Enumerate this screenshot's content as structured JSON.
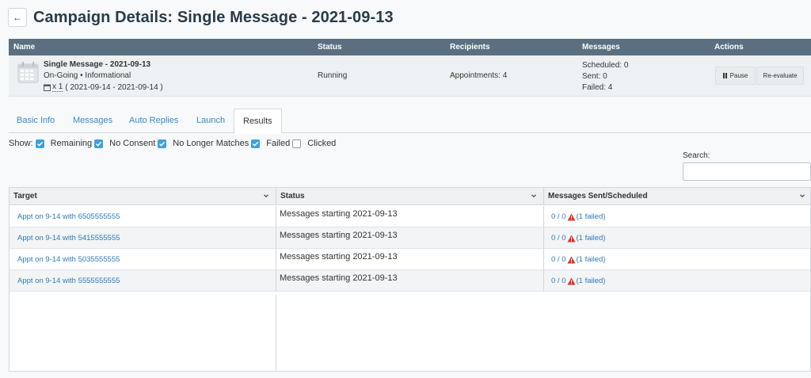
{
  "header": {
    "title": "Campaign Details: Single Message - 2021-09-13",
    "back_icon": "arrow-left-icon"
  },
  "campaign_table": {
    "columns": [
      "Name",
      "Status",
      "Recipients",
      "Messages",
      "Actions"
    ],
    "row": {
      "name": "Single Message - 2021-09-13",
      "subtitle": "On-Going • Informational",
      "count": "x 1",
      "range": "( 2021-09-14 - 2021-09-14 )",
      "status": "Running",
      "recipients": "Appointments: 4",
      "scheduled": "Scheduled: 0",
      "sent": "Sent: 0",
      "failed": "Failed: 4",
      "pause_label": "Pause",
      "reevaluate_label": "Re-evaluate"
    }
  },
  "tabs": [
    "Basic Info",
    "Messages",
    "Auto Replies",
    "Launch",
    "Results"
  ],
  "active_tab": "Results",
  "filters": {
    "show_label": "Show:",
    "items": [
      {
        "label": "Remaining",
        "checked": true
      },
      {
        "label": "No Consent",
        "checked": true
      },
      {
        "label": "No Longer Matches",
        "checked": true
      },
      {
        "label": "Failed",
        "checked": true
      },
      {
        "label": "Clicked",
        "checked": false
      }
    ]
  },
  "search": {
    "label": "Search:",
    "value": ""
  },
  "results": {
    "columns": [
      "Target",
      "Status",
      "Messages Sent/Scheduled"
    ],
    "rows": [
      {
        "target": "Appt on 9-14 with 6505555555",
        "status": "Messages starting 2021-09-13",
        "count": "0 / 0",
        "failed": "(1 failed)"
      },
      {
        "target": "Appt on 9-14 with 5415555555",
        "status": "Messages starting 2021-09-13",
        "count": "0 / 0",
        "failed": "(1 failed)"
      },
      {
        "target": "Appt on 9-14 with 5035555555",
        "status": "Messages starting 2021-09-13",
        "count": "0 / 0",
        "failed": "(1 failed)"
      },
      {
        "target": "Appt on 9-14 with 5555555555",
        "status": "Messages starting 2021-09-13",
        "count": "0 / 0",
        "failed": "(1 failed)"
      }
    ]
  },
  "colors": {
    "header_bg": "#5b6f80",
    "link": "#2e7ab8",
    "checkbox": "#3fa1da",
    "warning": "#d9342b"
  }
}
